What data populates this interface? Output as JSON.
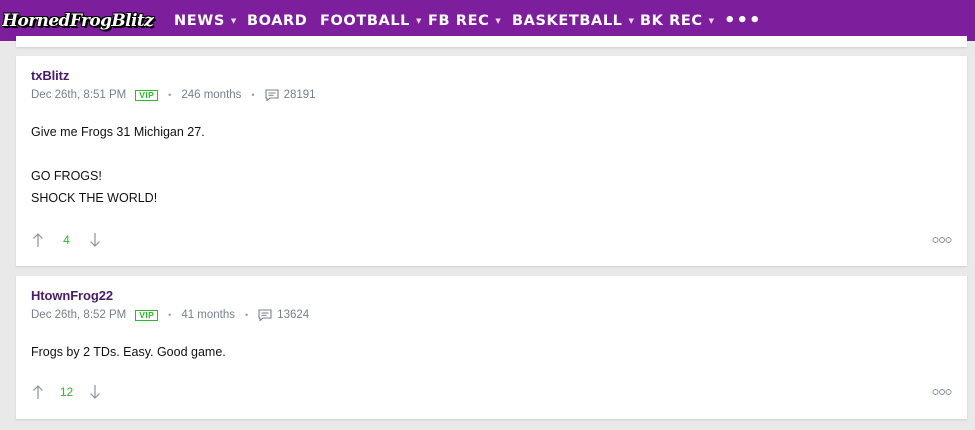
{
  "site": {
    "logo_text": "HornedFrogBlitz"
  },
  "nav": {
    "items": [
      {
        "label": "NEWS",
        "has_caret": true
      },
      {
        "label": "BOARD",
        "has_caret": false
      },
      {
        "label": "FOOTBALL",
        "has_caret": true
      },
      {
        "label": "FB REC",
        "has_caret": true
      },
      {
        "label": "BASKETBALL",
        "has_caret": true
      },
      {
        "label": "BK REC",
        "has_caret": true
      }
    ],
    "more_label": "•••",
    "caret_glyph": "▼"
  },
  "colors": {
    "nav_bg": "#7d1e9c",
    "author": "#4a1d6b",
    "vip": "#2eb82e",
    "score": "#35b23a",
    "meta": "#75818d"
  },
  "posts": [
    {
      "author": "txBlitz",
      "date": "Dec 26th, 8:51 PM",
      "badge": "VIP",
      "tenure": "246 months",
      "post_count": "28191",
      "body": [
        "Give me Frogs 31 Michigan 27.",
        "",
        "GO FROGS!",
        "SHOCK THE WORLD!"
      ],
      "score": "4",
      "icons": {
        "upvote": "arrow-up-icon",
        "downvote": "arrow-down-icon",
        "more": "more-options-icon",
        "posts": "message-icon"
      }
    },
    {
      "author": "HtownFrog22",
      "date": "Dec 26th, 8:52 PM",
      "badge": "VIP",
      "tenure": "41 months",
      "post_count": "13624",
      "body": [
        "Frogs by 2 TDs. Easy. Good game."
      ],
      "score": "12",
      "icons": {
        "upvote": "arrow-up-icon",
        "downvote": "arrow-down-icon",
        "more": "more-options-icon",
        "posts": "message-icon"
      }
    }
  ]
}
